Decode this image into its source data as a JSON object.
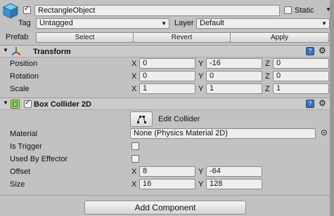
{
  "header": {
    "object_name": "RectangleObject",
    "static_label": "Static",
    "tag_label": "Tag",
    "tag_value": "Untagged",
    "layer_label": "Layer",
    "layer_value": "Default",
    "prefab_label": "Prefab",
    "prefab_buttons": [
      "Select",
      "Revert",
      "Apply"
    ]
  },
  "transform": {
    "title": "Transform",
    "rows": [
      {
        "label": "Position",
        "x": "0",
        "y": "-16",
        "z": "0"
      },
      {
        "label": "Rotation",
        "x": "0",
        "y": "0",
        "z": "0"
      },
      {
        "label": "Scale",
        "x": "1",
        "y": "1",
        "z": "1"
      }
    ]
  },
  "box_collider": {
    "title": "Box Collider 2D",
    "edit_collider_label": "Edit Collider",
    "material_label": "Material",
    "material_value": "None (Physics Material 2D)",
    "is_trigger_label": "Is Trigger",
    "used_by_effector_label": "Used By Effector",
    "offset_label": "Offset",
    "offset_x": "8",
    "offset_y": "-64",
    "size_label": "Size",
    "size_x": "16",
    "size_y": "128"
  },
  "axis_labels": {
    "x": "X",
    "y": "Y",
    "z": "Z"
  },
  "footer": {
    "add_component_label": "Add Component"
  }
}
